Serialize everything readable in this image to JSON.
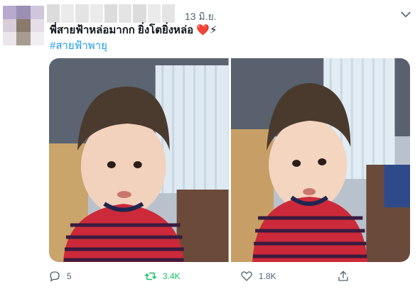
{
  "tweet": {
    "date": "13 มิ.ย.",
    "text": "พี่สายฟ้าหล่อมากก ยิ่งโตยิ่งหล่อ",
    "emoji": "❤️⚡",
    "hashtag": "#สายฟ้าพายุ"
  },
  "media": {
    "photos": [
      {
        "name": "child-photo-left"
      },
      {
        "name": "child-photo-right"
      }
    ]
  },
  "actions": {
    "reply_count": "5",
    "retweet_count": "3.4K",
    "like_count": "1.8K"
  },
  "colors": {
    "accent": "#1d9bf0",
    "retweet": "#17bf63",
    "muted": "#536471",
    "heart": "#e0245e"
  },
  "icons": [
    "chevron-down-icon",
    "reply-icon",
    "retweet-icon",
    "like-icon",
    "share-icon"
  ]
}
